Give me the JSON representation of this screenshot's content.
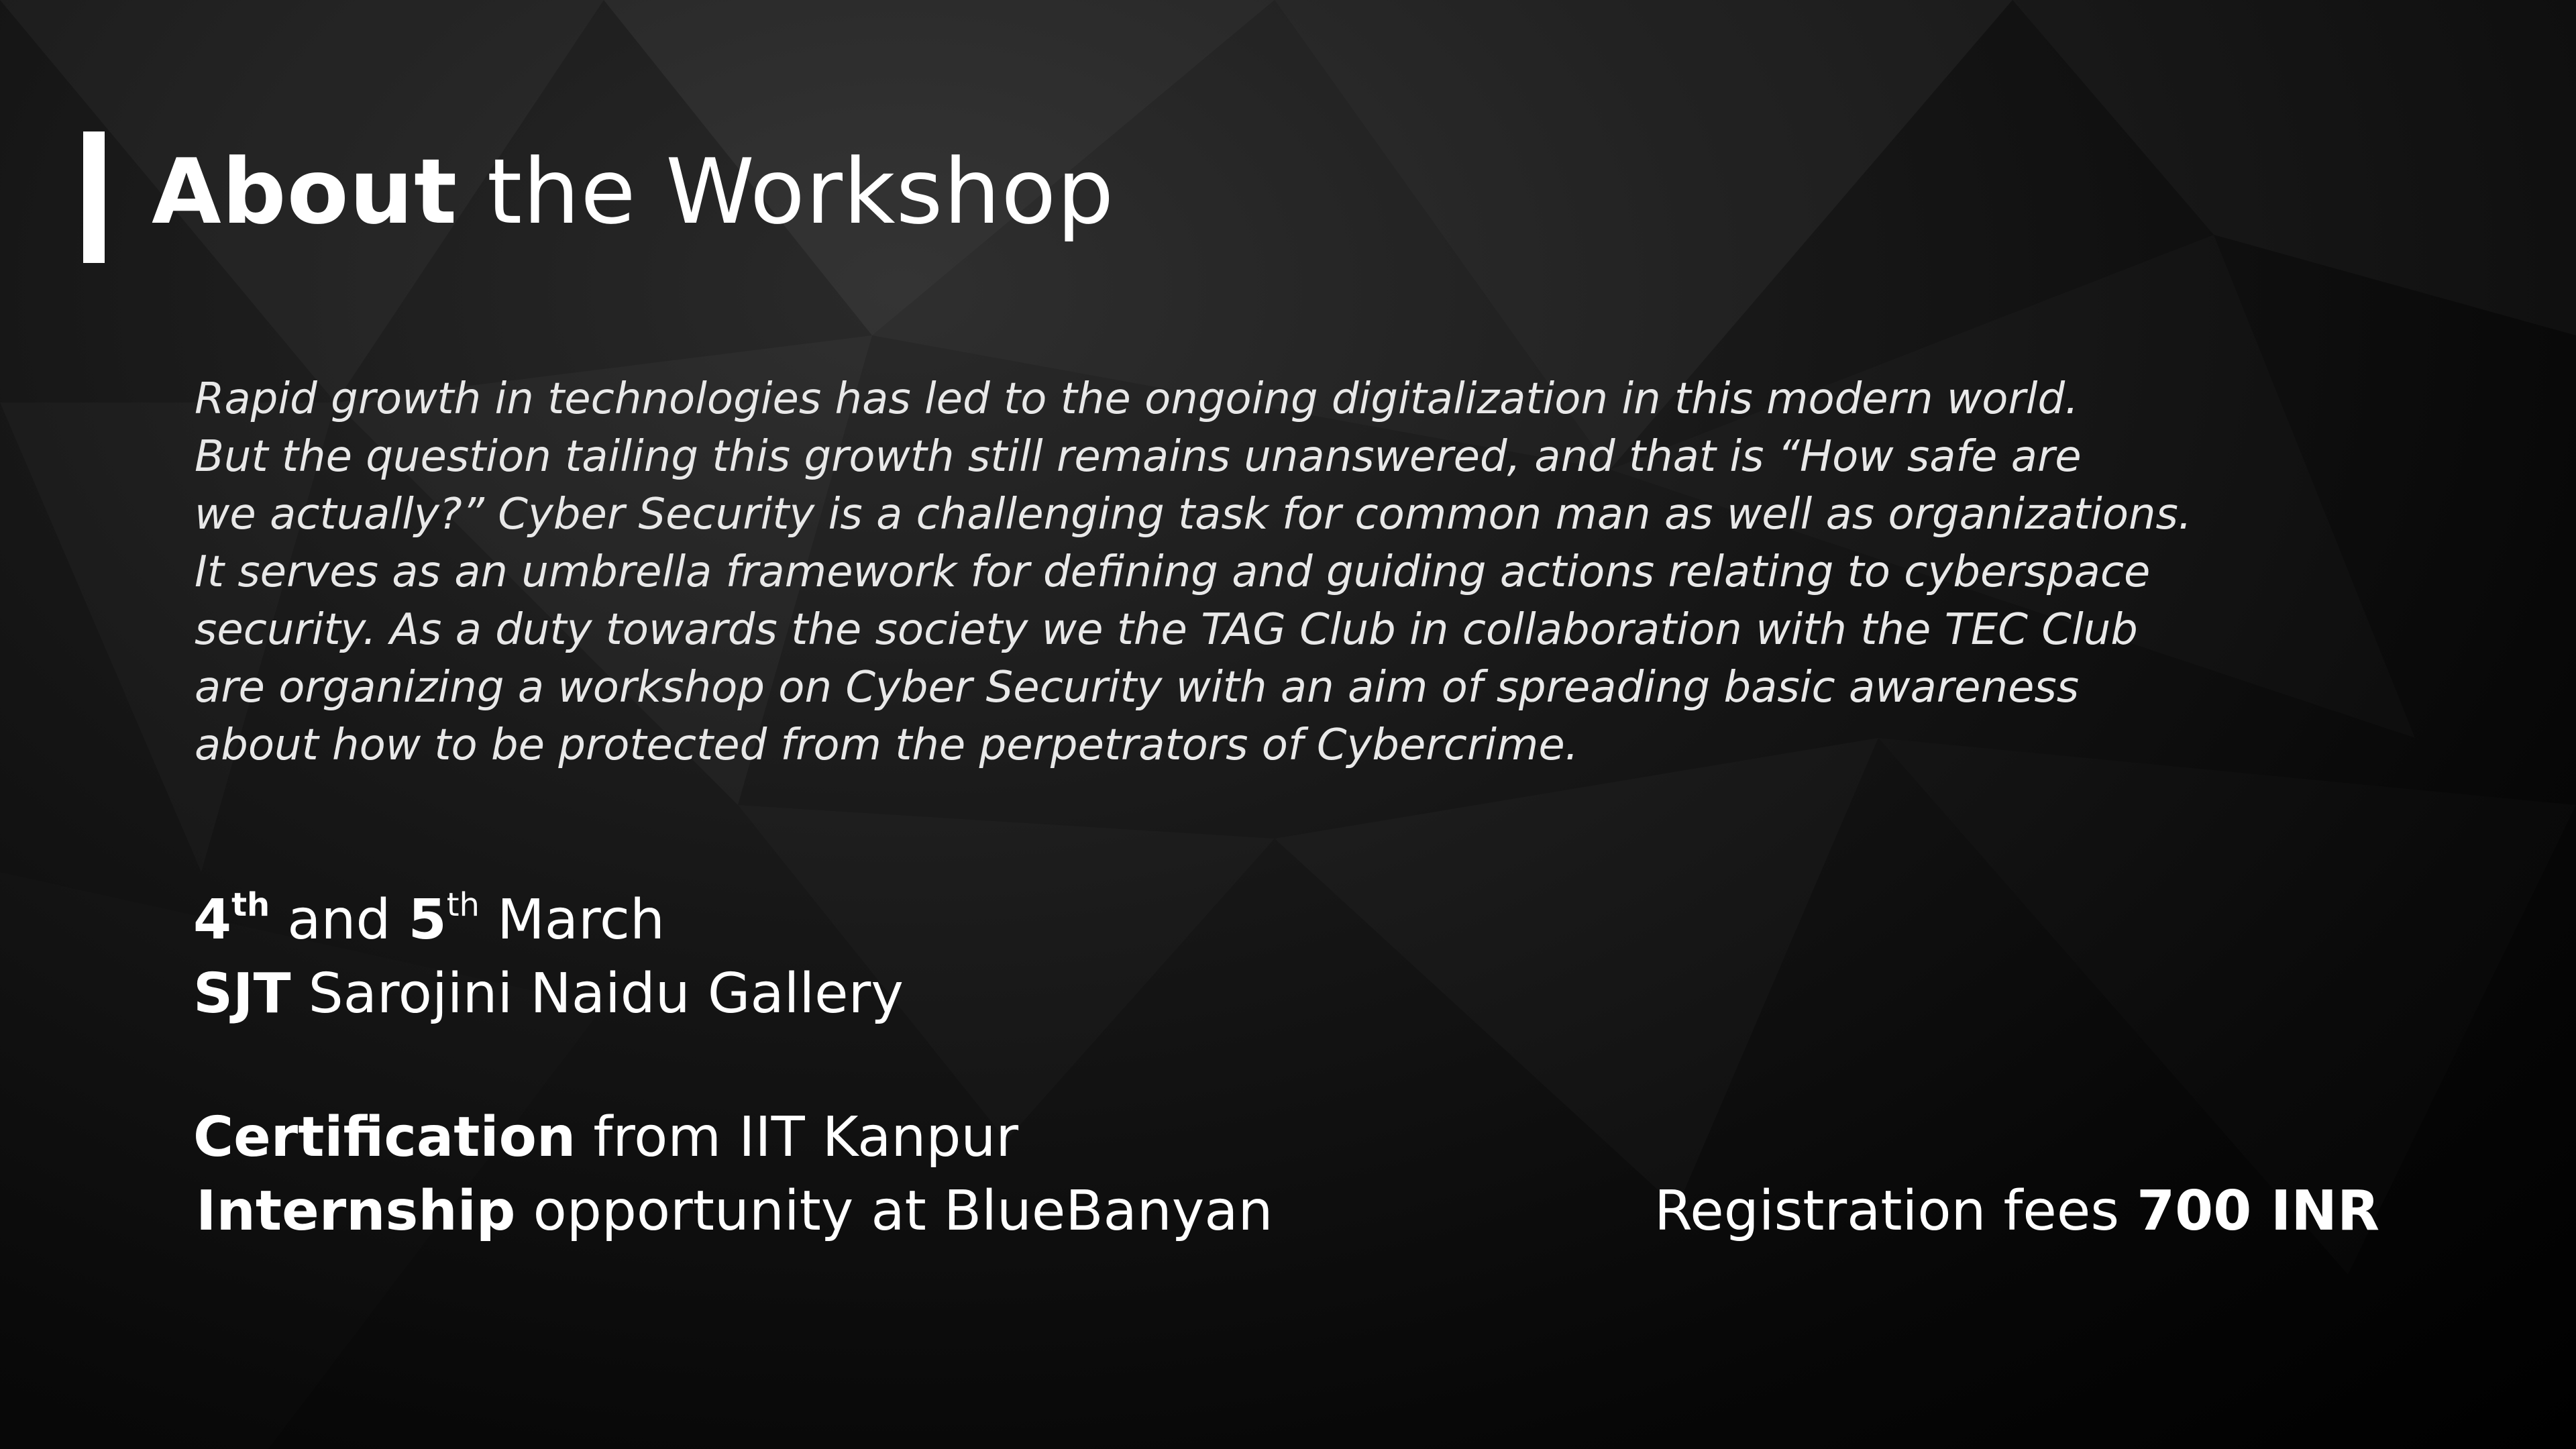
{
  "title": {
    "bold": "About",
    "regular": "the Workshop"
  },
  "description": [
    "Rapid growth in technologies has led to the ongoing digitalization in this modern world.",
    "But the question tailing this growth still remains unanswered, and that is “How safe are",
    "we actually?” Cyber Security is a challenging task for common man as well as organizations.",
    "It serves as an umbrella framework for defining and guiding actions relating to cyberspace",
    "security. As a duty towards the society we the TAG Club in collaboration with the TEC Club",
    "are organizing a workshop on Cyber Security with an aim of spreading basic awareness",
    "about how to be protected from the perpetrators of Cybercrime."
  ],
  "dates": {
    "day1": "4",
    "sup1": "th",
    "and": "and",
    "day2": "5",
    "sup2": "th",
    "month": "March"
  },
  "venue": {
    "bold": "SJT",
    "regular": "Sarojini Naidu Gallery"
  },
  "certification": {
    "bold": "Certification",
    "regular": "from IIT Kanpur"
  },
  "internship": {
    "bold": "Internship",
    "regular": "opportunity at BlueBanyan"
  },
  "fees": {
    "label": "Registration fees",
    "amount": "700 INR"
  },
  "colors": {
    "background": "#000000",
    "text": "#ffffff",
    "accent": "#ffffff"
  }
}
